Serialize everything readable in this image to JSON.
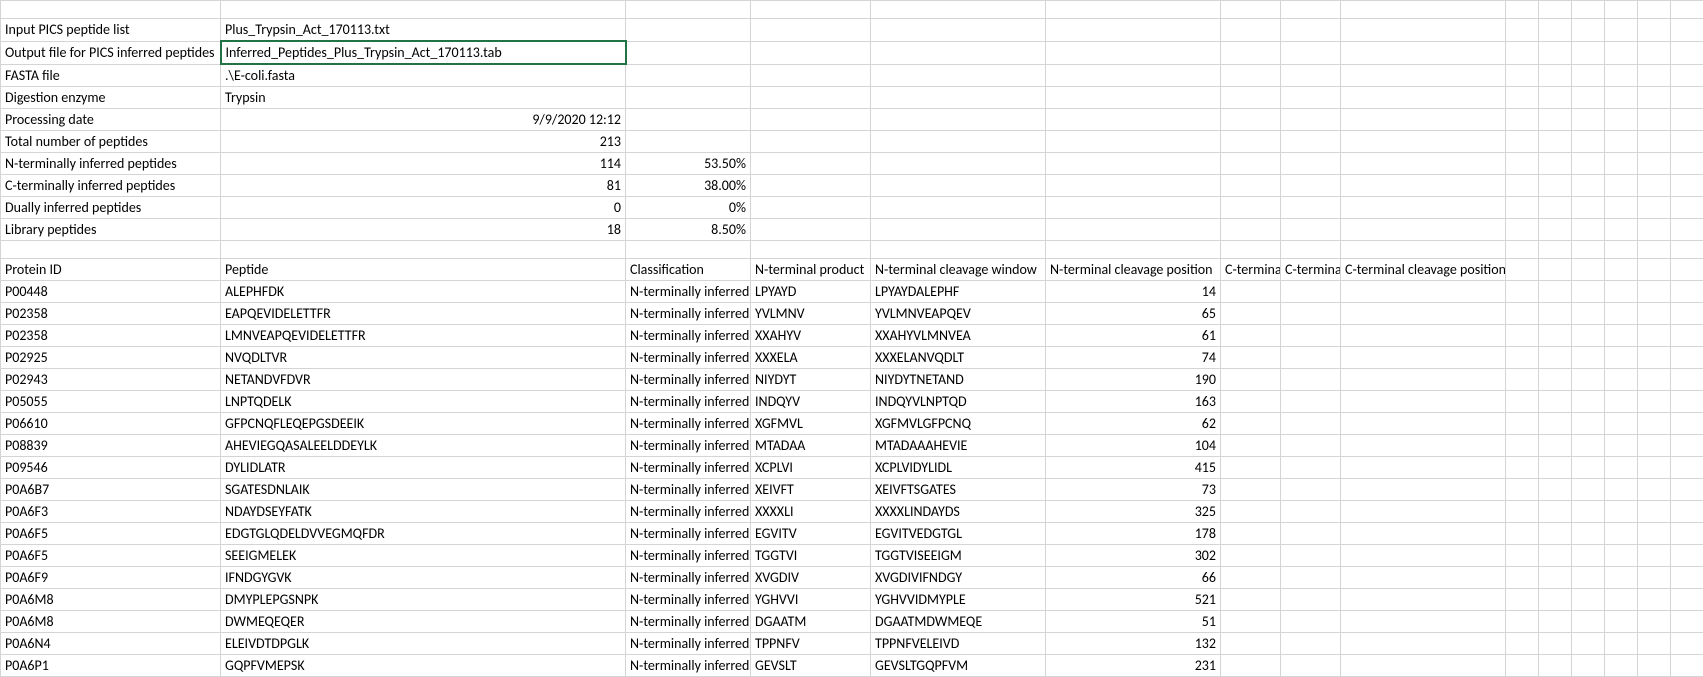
{
  "meta": [
    {
      "label": "",
      "value": "",
      "pct": ""
    },
    {
      "label": "Input PICS peptide list",
      "value": "Plus_Trypsin_Act_170113.txt",
      "pct": ""
    },
    {
      "label": "Output file for PICS inferred peptides",
      "value": "Inferred_Peptides_Plus_Trypsin_Act_170113.tab",
      "pct": "",
      "selected": true
    },
    {
      "label": "FASTA file",
      "value": ".\\E-coli.fasta",
      "pct": ""
    },
    {
      "label": "Digestion enzyme",
      "value": "Trypsin",
      "pct": ""
    },
    {
      "label": "Processing date",
      "value": "9/9/2020 12:12",
      "pct": "",
      "num": true
    },
    {
      "label": "Total number of peptides",
      "value": "213",
      "pct": "",
      "num": true
    },
    {
      "label": "N-terminally inferred peptides",
      "value": "114",
      "pct": "53.50%",
      "num": true
    },
    {
      "label": "C-terminally inferred peptides",
      "value": "81",
      "pct": "38.00%",
      "num": true
    },
    {
      "label": "Dually inferred peptides",
      "value": "0",
      "pct": "0%",
      "num": true
    },
    {
      "label": "Library peptides",
      "value": "18",
      "pct": "8.50%",
      "num": true
    },
    {
      "label": "",
      "value": "",
      "pct": ""
    }
  ],
  "headers": {
    "a": "Protein ID",
    "b": "Peptide",
    "c": "Classification",
    "d": "N-terminal product",
    "e": "N-terminal cleavage window",
    "f": "N-terminal cleavage position",
    "g": "C-termina",
    "h": "C-termina",
    "i": "C-terminal cleavage position"
  },
  "rows": [
    {
      "id": "P00448",
      "pep": "ALEPHFDK",
      "cls": "N-terminally inferred",
      "np": "LPYAYD",
      "nw": "LPYAYDALEPHF",
      "pos": "14"
    },
    {
      "id": "P02358",
      "pep": "EAPQEVIDELETTFR",
      "cls": "N-terminally inferred",
      "np": "YVLMNV",
      "nw": "YVLMNVEAPQEV",
      "pos": "65"
    },
    {
      "id": "P02358",
      "pep": "LMNVEAPQEVIDELETTFR",
      "cls": "N-terminally inferred",
      "np": "XXAHYV",
      "nw": "XXAHYVLMNVEA",
      "pos": "61"
    },
    {
      "id": "P02925",
      "pep": "NVQDLTVR",
      "cls": "N-terminally inferred",
      "np": "XXXELA",
      "nw": "XXXELANVQDLT",
      "pos": "74"
    },
    {
      "id": "P02943",
      "pep": "NETANDVFDVR",
      "cls": "N-terminally inferred",
      "np": "NIYDYT",
      "nw": "NIYDYTNETAND",
      "pos": "190"
    },
    {
      "id": "P05055",
      "pep": "LNPTQDELK",
      "cls": "N-terminally inferred",
      "np": "INDQYV",
      "nw": "INDQYVLNPTQD",
      "pos": "163"
    },
    {
      "id": "P06610",
      "pep": "GFPCNQFLEQEPGSDEEIK",
      "cls": "N-terminally inferred",
      "np": "XGFMVL",
      "nw": "XGFMVLGFPCNQ",
      "pos": "62"
    },
    {
      "id": "P08839",
      "pep": "AHEVIEGQASALEELDDEYLK",
      "cls": "N-terminally inferred",
      "np": "MTADAA",
      "nw": "MTADAAAHEVIE",
      "pos": "104"
    },
    {
      "id": "P09546",
      "pep": "DYLIDLATR",
      "cls": "N-terminally inferred",
      "np": "XCPLVI",
      "nw": "XCPLVIDYLIDL",
      "pos": "415"
    },
    {
      "id": "P0A6B7",
      "pep": "SGATESDNLAIK",
      "cls": "N-terminally inferred",
      "np": "XEIVFT",
      "nw": "XEIVFTSGATES",
      "pos": "73"
    },
    {
      "id": "P0A6F3",
      "pep": "NDAYDSEYFATK",
      "cls": "N-terminally inferred",
      "np": "XXXXLI",
      "nw": "XXXXLINDAYDS",
      "pos": "325"
    },
    {
      "id": "P0A6F5",
      "pep": "EDGTGLQDELDVVEGMQFDR",
      "cls": "N-terminally inferred",
      "np": "EGVITV",
      "nw": "EGVITVEDGTGL",
      "pos": "178"
    },
    {
      "id": "P0A6F5",
      "pep": "SEEIGMELEK",
      "cls": "N-terminally inferred",
      "np": "TGGTVI",
      "nw": "TGGTVISEEIGM",
      "pos": "302"
    },
    {
      "id": "P0A6F9",
      "pep": "IFNDGYGVK",
      "cls": "N-terminally inferred",
      "np": "XVGDIV",
      "nw": "XVGDIVIFNDGY",
      "pos": "66"
    },
    {
      "id": "P0A6M8",
      "pep": "DMYPLEPGSNPK",
      "cls": "N-terminally inferred",
      "np": "YGHVVI",
      "nw": "YGHVVIDMYPLE",
      "pos": "521"
    },
    {
      "id": "P0A6M8",
      "pep": "DWMEQEQER",
      "cls": "N-terminally inferred",
      "np": "DGAATM",
      "nw": "DGAATMDWMEQE",
      "pos": "51"
    },
    {
      "id": "P0A6N4",
      "pep": "ELEIVDTDPGLK",
      "cls": "N-terminally inferred",
      "np": "TPPNFV",
      "nw": "TPPNFVELEIVD",
      "pos": "132"
    },
    {
      "id": "P0A6P1",
      "pep": "GQPFVMEPSK",
      "cls": "N-terminally inferred",
      "np": "GEVSLT",
      "nw": "GEVSLTGQPFVM",
      "pos": "231"
    }
  ]
}
